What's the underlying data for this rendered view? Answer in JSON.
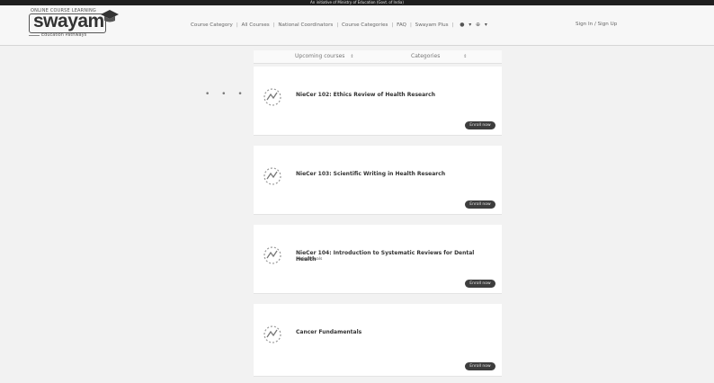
{
  "topbar": {
    "text": "An initiative of Ministry of Education (Govt. of India)"
  },
  "logo": {
    "top_tag": "ONLINE COURSE LEARNING",
    "word": "swayam",
    "bottom_tag": "Education Pathways"
  },
  "nav": {
    "items": [
      "Course Category",
      "All Courses",
      "National Coordinators",
      "Course Categories",
      "FAQ",
      "Swayam Plus"
    ],
    "signin": "Sign In / Sign Up"
  },
  "filters": {
    "left_label": "Upcoming courses",
    "right_label": "Categories"
  },
  "courses": [
    {
      "title": "NieCer 102: Ethics Review of Health Research",
      "subtitle": "",
      "button": "Enroll now"
    },
    {
      "title": "NieCer 103: Scientific Writing in Health Research",
      "subtitle": "",
      "button": "Enroll now"
    },
    {
      "title": "NieCer 104: Introduction to Systematic Reviews for Dental Health",
      "subtitle": "Professionals",
      "button": "Enroll now"
    },
    {
      "title": "Cancer Fundamentals",
      "subtitle": "",
      "button": "Enroll now"
    }
  ],
  "icons": {
    "user": "user-icon",
    "language": "globe-icon",
    "dropdown": "chevron-down-icon"
  },
  "colors": {
    "topbar": "#1f1f1f",
    "button": "#3d3d3d",
    "background": "#f2f2f2"
  }
}
